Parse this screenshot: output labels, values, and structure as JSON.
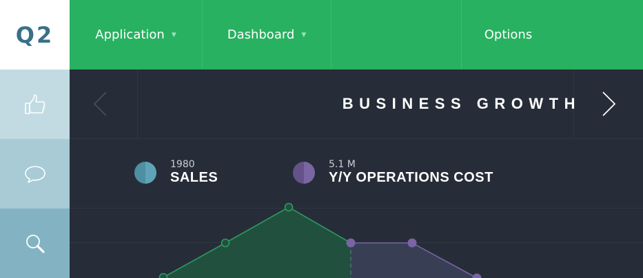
{
  "logo": {
    "text": "Q2"
  },
  "nav": {
    "application": "Application",
    "dashboard": "Dashboard",
    "options": "Options"
  },
  "sidebar": {
    "items": [
      {
        "icon": "thumbs-up-icon",
        "color": "#c2dbe2"
      },
      {
        "icon": "chat-bubble-icon",
        "color": "#a8cbd6"
      },
      {
        "icon": "search-icon",
        "color": "#83b3c3"
      }
    ]
  },
  "panel": {
    "title": "BUSINESS GROWTH"
  },
  "legend": {
    "sales": {
      "value": "1980",
      "label": "SALES",
      "color": "#5193a8"
    },
    "operations": {
      "value": "5.1 M",
      "label": "Y/Y OPERATIONS COST",
      "color": "#6e5a93"
    }
  },
  "colors": {
    "header": "#28b160",
    "background": "#262d38",
    "sales_line": "#2d9a5f",
    "operations_line": "#7a63a6"
  }
}
